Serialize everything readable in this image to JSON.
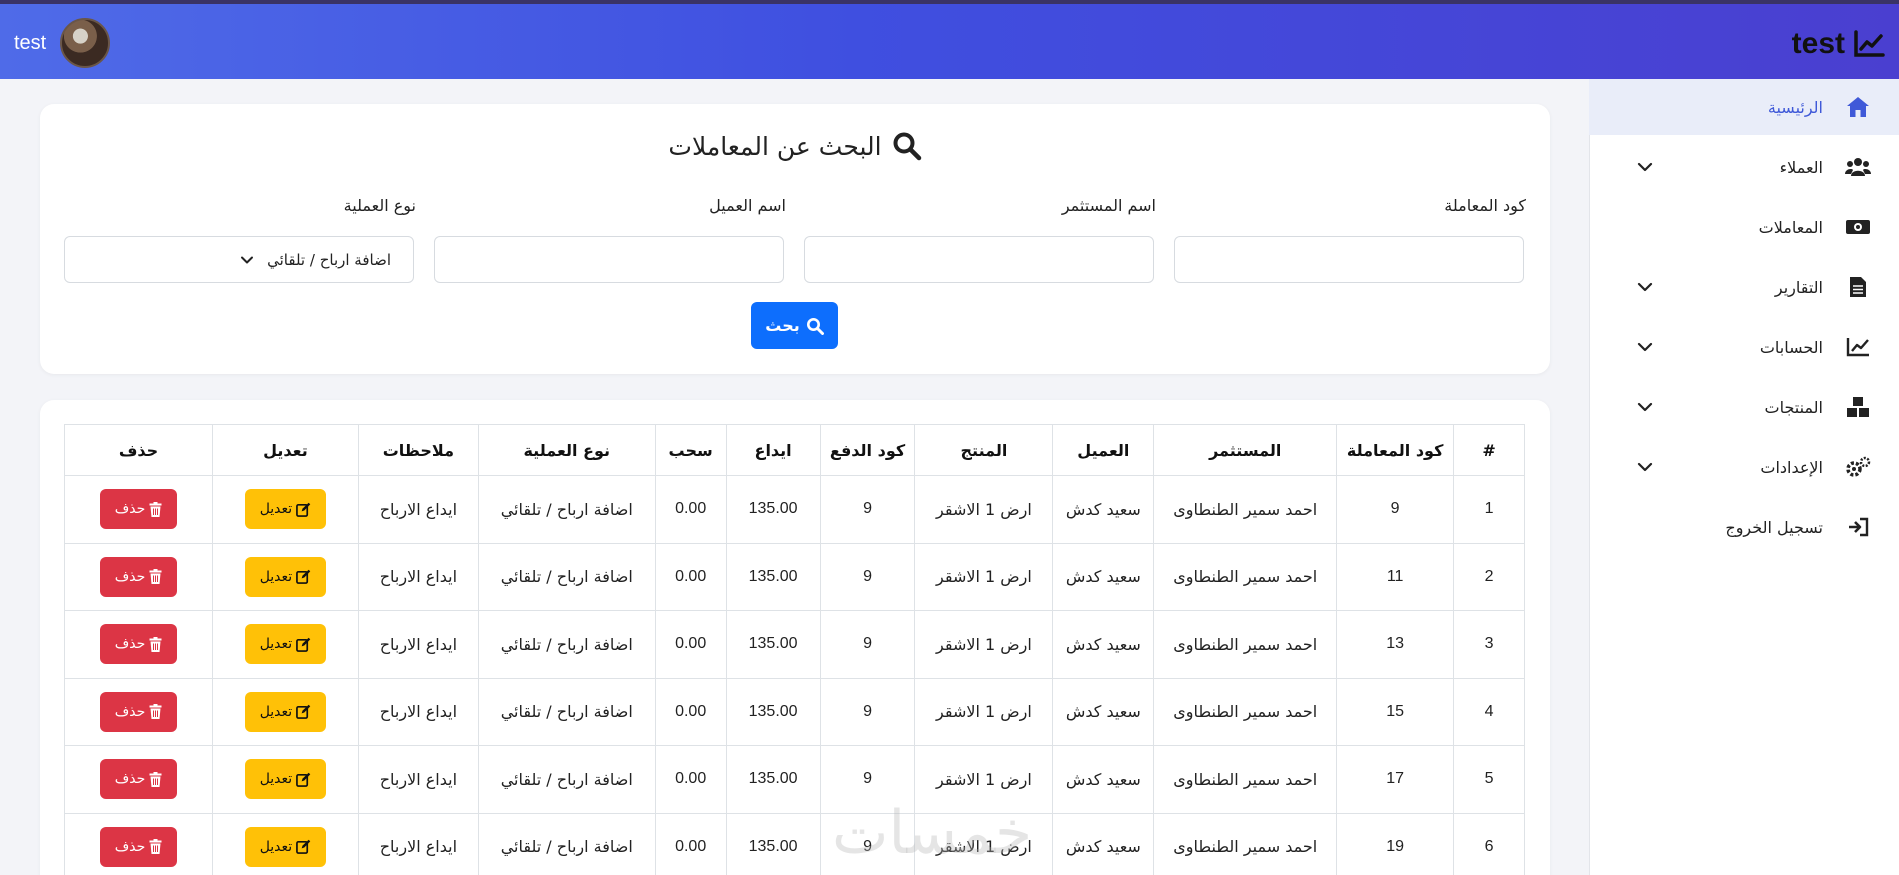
{
  "header": {
    "brand": "test",
    "user_name": "test"
  },
  "sidebar": {
    "items": [
      {
        "label": "الرئيسية",
        "icon": "home-icon",
        "active": true,
        "has_submenu": false
      },
      {
        "label": "العملاء",
        "icon": "users-icon",
        "active": false,
        "has_submenu": true
      },
      {
        "label": "المعاملات",
        "icon": "money-icon",
        "active": false,
        "has_submenu": false
      },
      {
        "label": "التقارير",
        "icon": "file-icon",
        "active": false,
        "has_submenu": true
      },
      {
        "label": "الحسابات",
        "icon": "chart-line-icon",
        "active": false,
        "has_submenu": true
      },
      {
        "label": "المنتجات",
        "icon": "boxes-icon",
        "active": false,
        "has_submenu": true
      },
      {
        "label": "الإعدادات",
        "icon": "gears-icon",
        "active": false,
        "has_submenu": true
      },
      {
        "label": "تسجيل الخروج",
        "icon": "logout-icon",
        "active": false,
        "has_submenu": false
      }
    ]
  },
  "search": {
    "title": "البحث عن المعاملات",
    "fields": {
      "code": {
        "label": "كود المعاملة",
        "value": ""
      },
      "investor": {
        "label": "اسم المستثمر",
        "value": ""
      },
      "client": {
        "label": "اسم العميل",
        "value": ""
      },
      "op_type": {
        "label": "نوع العملية",
        "value": "اضافة ارباح / تلقائي"
      }
    },
    "button_label": "بحث"
  },
  "table": {
    "columns": [
      "#",
      "كود المعاملة",
      "المستثمر",
      "العميل",
      "المنتج",
      "كود الدفع",
      "ايداع",
      "سحب",
      "نوع العملية",
      "ملاحظات",
      "تعديل",
      "حذف"
    ],
    "edit_label": "تعديل",
    "delete_label": "حذف",
    "rows": [
      [
        "1",
        "9",
        "احمد سمير الطنطاوى",
        "سعيد كدش",
        "ارض 1 الاشقر",
        "9",
        "135.00",
        "0.00",
        "اضافة ارباح / تلقائي",
        "ايداع الارباح"
      ],
      [
        "2",
        "11",
        "احمد سمير الطنطاوى",
        "سعيد كدش",
        "ارض 1 الاشقر",
        "9",
        "135.00",
        "0.00",
        "اضافة ارباح / تلقائي",
        "ايداع الارباح"
      ],
      [
        "3",
        "13",
        "احمد سمير الطنطاوى",
        "سعيد كدش",
        "ارض 1 الاشقر",
        "9",
        "135.00",
        "0.00",
        "اضافة ارباح / تلقائي",
        "ايداع الارباح"
      ],
      [
        "4",
        "15",
        "احمد سمير الطنطاوى",
        "سعيد كدش",
        "ارض 1 الاشقر",
        "9",
        "135.00",
        "0.00",
        "اضافة ارباح / تلقائي",
        "ايداع الارباح"
      ],
      [
        "5",
        "17",
        "احمد سمير الطنطاوى",
        "سعيد كدش",
        "ارض 1 الاشقر",
        "9",
        "135.00",
        "0.00",
        "اضافة ارباح / تلقائي",
        "ايداع الارباح"
      ],
      [
        "6",
        "19",
        "احمد سمير الطنطاوى",
        "سعيد كدش",
        "ارض 1 الاشقر",
        "9",
        "135.00",
        "0.00",
        "اضافة ارباح / تلقائي",
        "ايداع الارباح"
      ]
    ]
  },
  "watermark": "خمسات",
  "colors": {
    "accent": "#3f59d8",
    "primary": "#0d6efd",
    "warning": "#ffc107",
    "danger": "#dc3545"
  }
}
